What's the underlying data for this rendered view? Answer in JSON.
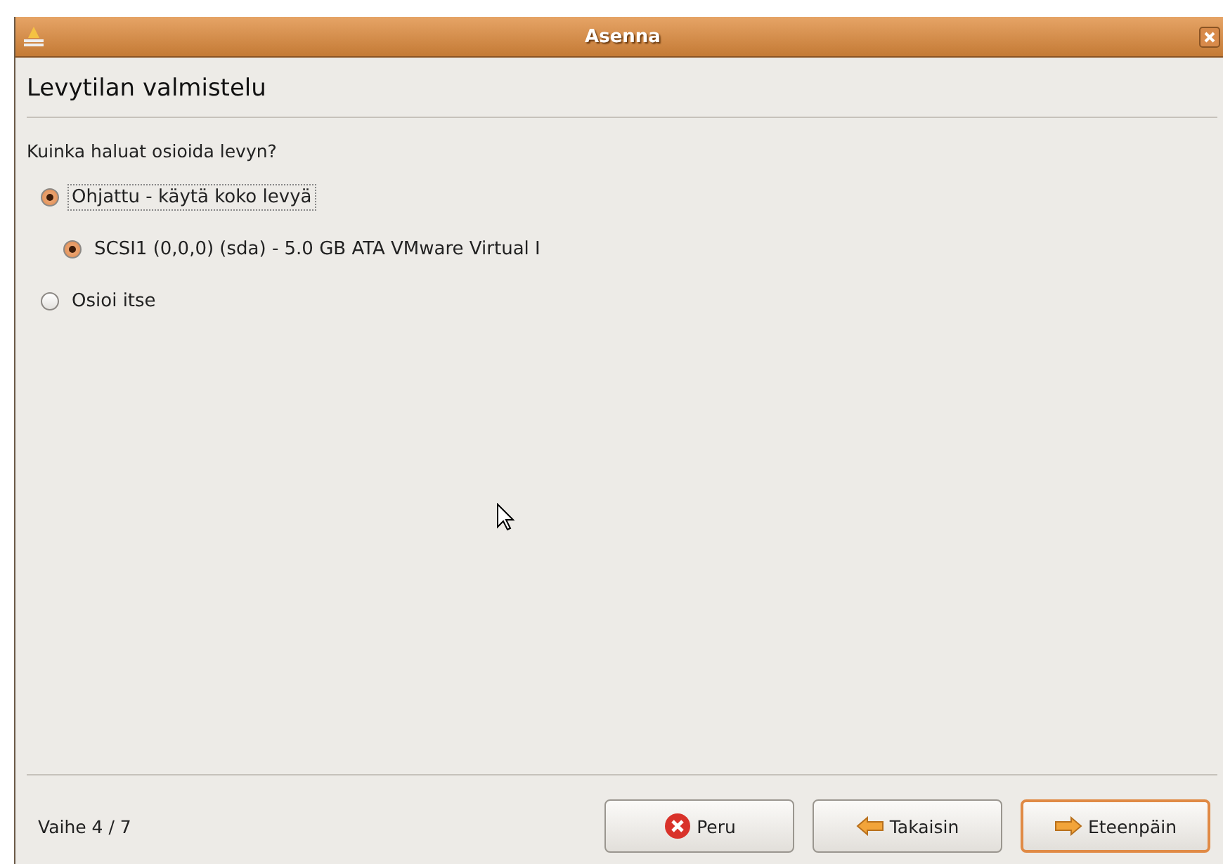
{
  "window": {
    "title": "Asenna"
  },
  "heading": "Levytilan valmistelu",
  "question": "Kuinka haluat osioida levyn?",
  "options": [
    {
      "label": "Ohjattu - käytä koko levyä",
      "selected": true,
      "focused": true,
      "children": [
        {
          "label": "SCSI1 (0,0,0) (sda) - 5.0 GB ATA VMware Virtual I",
          "selected": true,
          "focused": false
        }
      ]
    },
    {
      "label": "Osioi itse",
      "selected": false,
      "focused": false
    }
  ],
  "step": "Vaihe 4 / 7",
  "buttons": [
    {
      "kind": "cancel",
      "label": "Peru",
      "default": false
    },
    {
      "kind": "back",
      "label": "Takaisin",
      "default": false
    },
    {
      "kind": "forward",
      "label": "Eteenpäin",
      "default": true
    }
  ]
}
